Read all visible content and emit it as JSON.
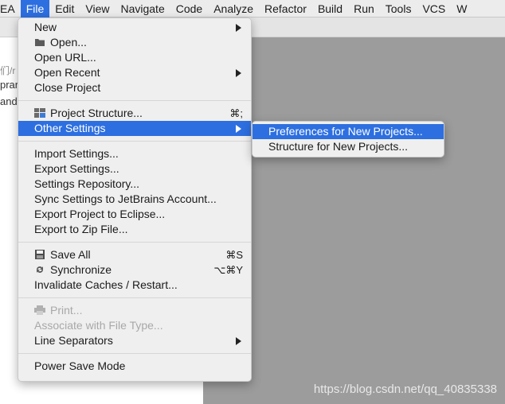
{
  "menubar": {
    "items": [
      {
        "label": "EA"
      },
      {
        "label": "File",
        "active": true
      },
      {
        "label": "Edit"
      },
      {
        "label": "View"
      },
      {
        "label": "Navigate"
      },
      {
        "label": "Code"
      },
      {
        "label": "Analyze"
      },
      {
        "label": "Refactor"
      },
      {
        "label": "Build"
      },
      {
        "label": "Run"
      },
      {
        "label": "Tools"
      },
      {
        "label": "VCS"
      },
      {
        "label": "W"
      }
    ]
  },
  "background": {
    "fragments": [
      "们/r",
      "prar",
      "and"
    ]
  },
  "file_menu": {
    "groups": [
      [
        {
          "label": "New",
          "submenu": true
        },
        {
          "label": "Open...",
          "icon": "folder-icon"
        },
        {
          "label": "Open URL..."
        },
        {
          "label": "Open Recent",
          "submenu": true
        },
        {
          "label": "Close Project"
        }
      ],
      [
        {
          "label": "Project Structure...",
          "icon": "project-structure-icon",
          "shortcut": "⌘;"
        },
        {
          "label": "Other Settings",
          "submenu": true,
          "highlight": true
        }
      ],
      [
        {
          "label": "Import Settings..."
        },
        {
          "label": "Export Settings..."
        },
        {
          "label": "Settings Repository..."
        },
        {
          "label": "Sync Settings to JetBrains Account..."
        },
        {
          "label": "Export Project to Eclipse..."
        },
        {
          "label": "Export to Zip File..."
        }
      ],
      [
        {
          "label": "Save All",
          "icon": "save-icon",
          "shortcut": "⌘S"
        },
        {
          "label": "Synchronize",
          "icon": "sync-icon",
          "shortcut": "⌥⌘Y"
        },
        {
          "label": "Invalidate Caches / Restart..."
        }
      ],
      [
        {
          "label": "Print...",
          "icon": "print-icon",
          "disabled": true
        },
        {
          "label": "Associate with File Type...",
          "disabled": true
        },
        {
          "label": "Line Separators",
          "submenu": true
        }
      ],
      [
        {
          "label": "Power Save Mode"
        }
      ]
    ]
  },
  "submenu": {
    "items": [
      {
        "label": "Preferences for New Projects...",
        "highlight": true
      },
      {
        "label": "Structure for New Projects..."
      }
    ]
  },
  "watermark": "https://blog.csdn.net/qq_40835338",
  "colors": {
    "highlight": "#2d6fe0",
    "menu_bg": "#efefef",
    "background_gray": "#9c9c9c"
  }
}
